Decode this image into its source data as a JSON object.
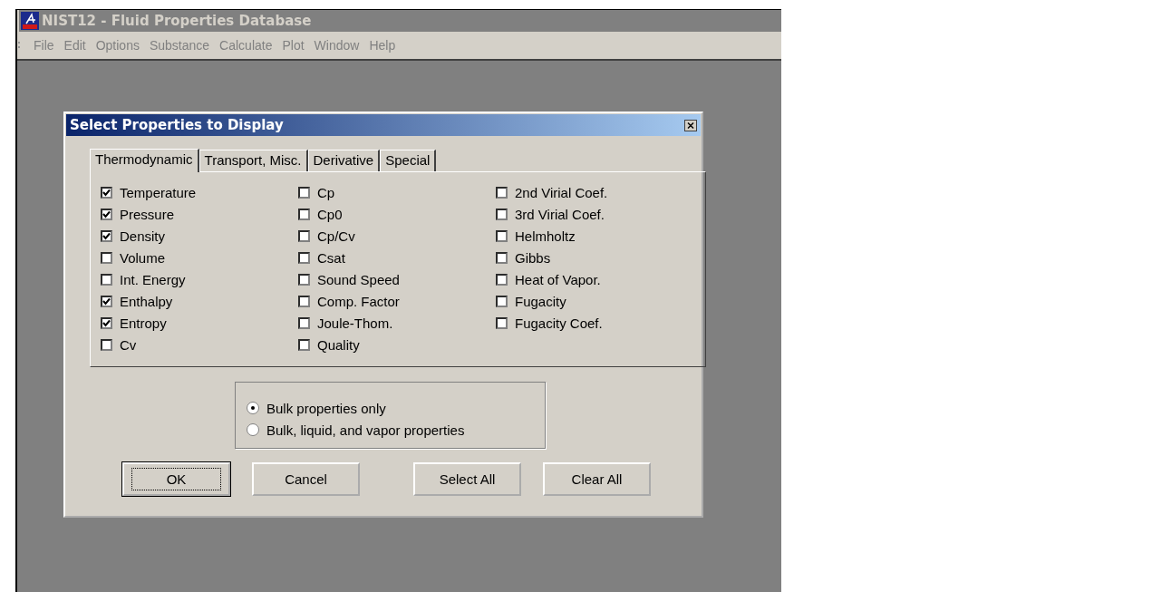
{
  "window": {
    "title": "NIST12 - Fluid Properties Database"
  },
  "menu": [
    "File",
    "Edit",
    "Options",
    "Substance",
    "Calculate",
    "Plot",
    "Window",
    "Help"
  ],
  "dialog": {
    "title": "Select Properties to Display",
    "tabs": [
      {
        "label": "Thermodynamic",
        "selected": true
      },
      {
        "label": "Transport, Misc.",
        "selected": false
      },
      {
        "label": "Derivative",
        "selected": false
      },
      {
        "label": "Special",
        "selected": false
      }
    ],
    "columns": [
      [
        {
          "label": "Temperature",
          "checked": true
        },
        {
          "label": "Pressure",
          "checked": true
        },
        {
          "label": "Density",
          "checked": true
        },
        {
          "label": "Volume",
          "checked": false
        },
        {
          "label": "Int. Energy",
          "checked": false
        },
        {
          "label": "Enthalpy",
          "checked": true
        },
        {
          "label": "Entropy",
          "checked": true
        },
        {
          "label": "Cv",
          "checked": false
        }
      ],
      [
        {
          "label": "Cp",
          "checked": false
        },
        {
          "label": "Cp0",
          "checked": false
        },
        {
          "label": "Cp/Cv",
          "checked": false
        },
        {
          "label": "Csat",
          "checked": false
        },
        {
          "label": "Sound Speed",
          "checked": false
        },
        {
          "label": "Comp. Factor",
          "checked": false
        },
        {
          "label": "Joule-Thom.",
          "checked": false
        },
        {
          "label": "Quality",
          "checked": false
        }
      ],
      [
        {
          "label": "2nd Virial Coef.",
          "checked": false
        },
        {
          "label": "3rd Virial Coef.",
          "checked": false
        },
        {
          "label": "Helmholtz",
          "checked": false
        },
        {
          "label": "Gibbs",
          "checked": false
        },
        {
          "label": "Heat of Vapor.",
          "checked": false
        },
        {
          "label": "Fugacity",
          "checked": false
        },
        {
          "label": "Fugacity Coef.",
          "checked": false
        }
      ]
    ],
    "options": [
      {
        "label": "Bulk properties only",
        "selected": true
      },
      {
        "label": "Bulk, liquid, and vapor properties",
        "selected": false
      }
    ],
    "buttons": [
      {
        "label": "OK",
        "default": true
      },
      {
        "label": "Cancel",
        "default": false
      },
      {
        "label": "Select All",
        "default": false
      },
      {
        "label": "Clear All",
        "default": false
      }
    ]
  }
}
